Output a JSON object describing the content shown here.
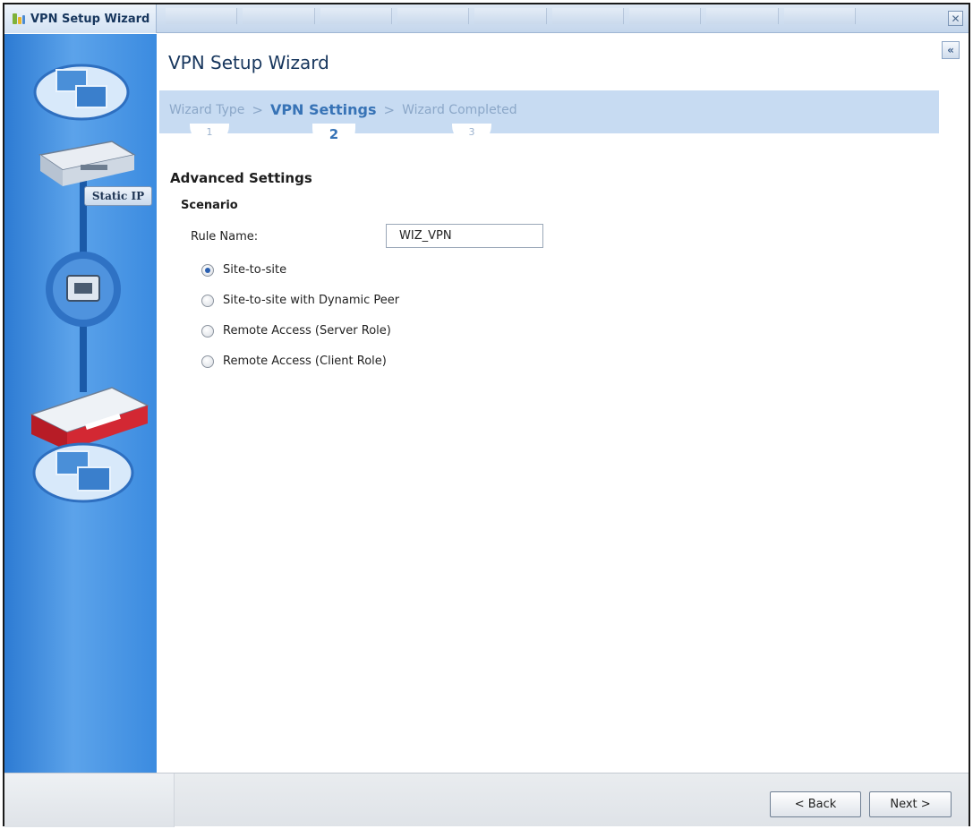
{
  "window": {
    "title": "VPN Setup Wizard",
    "close_icon": "close-icon"
  },
  "sidebar": {
    "connection_label": "Static IP"
  },
  "main": {
    "page_title": "VPN Setup Wizard",
    "collapse_icon": "double-chevron-left-icon",
    "steps": [
      {
        "label": "Wizard Type",
        "number": "1"
      },
      {
        "label": "VPN Settings",
        "number": "2"
      },
      {
        "label": "Wizard Completed",
        "number": "3"
      }
    ],
    "step_separator": ">",
    "section_title": "Advanced Settings",
    "subsection_title": "Scenario",
    "rule_name_label": "Rule Name:",
    "rule_name_value": "WIZ_VPN",
    "scenarios": [
      {
        "label": "Site-to-site",
        "checked": true
      },
      {
        "label": "Site-to-site with Dynamic Peer",
        "checked": false
      },
      {
        "label": "Remote Access (Server Role)",
        "checked": false
      },
      {
        "label": "Remote Access (Client Role)",
        "checked": false
      }
    ]
  },
  "footer": {
    "back_label": "< Back",
    "next_label": "Next >"
  },
  "colors": {
    "accent": "#3773b6",
    "steps_bar": "#c7dbf2",
    "sidebar": "#3b8be0"
  }
}
